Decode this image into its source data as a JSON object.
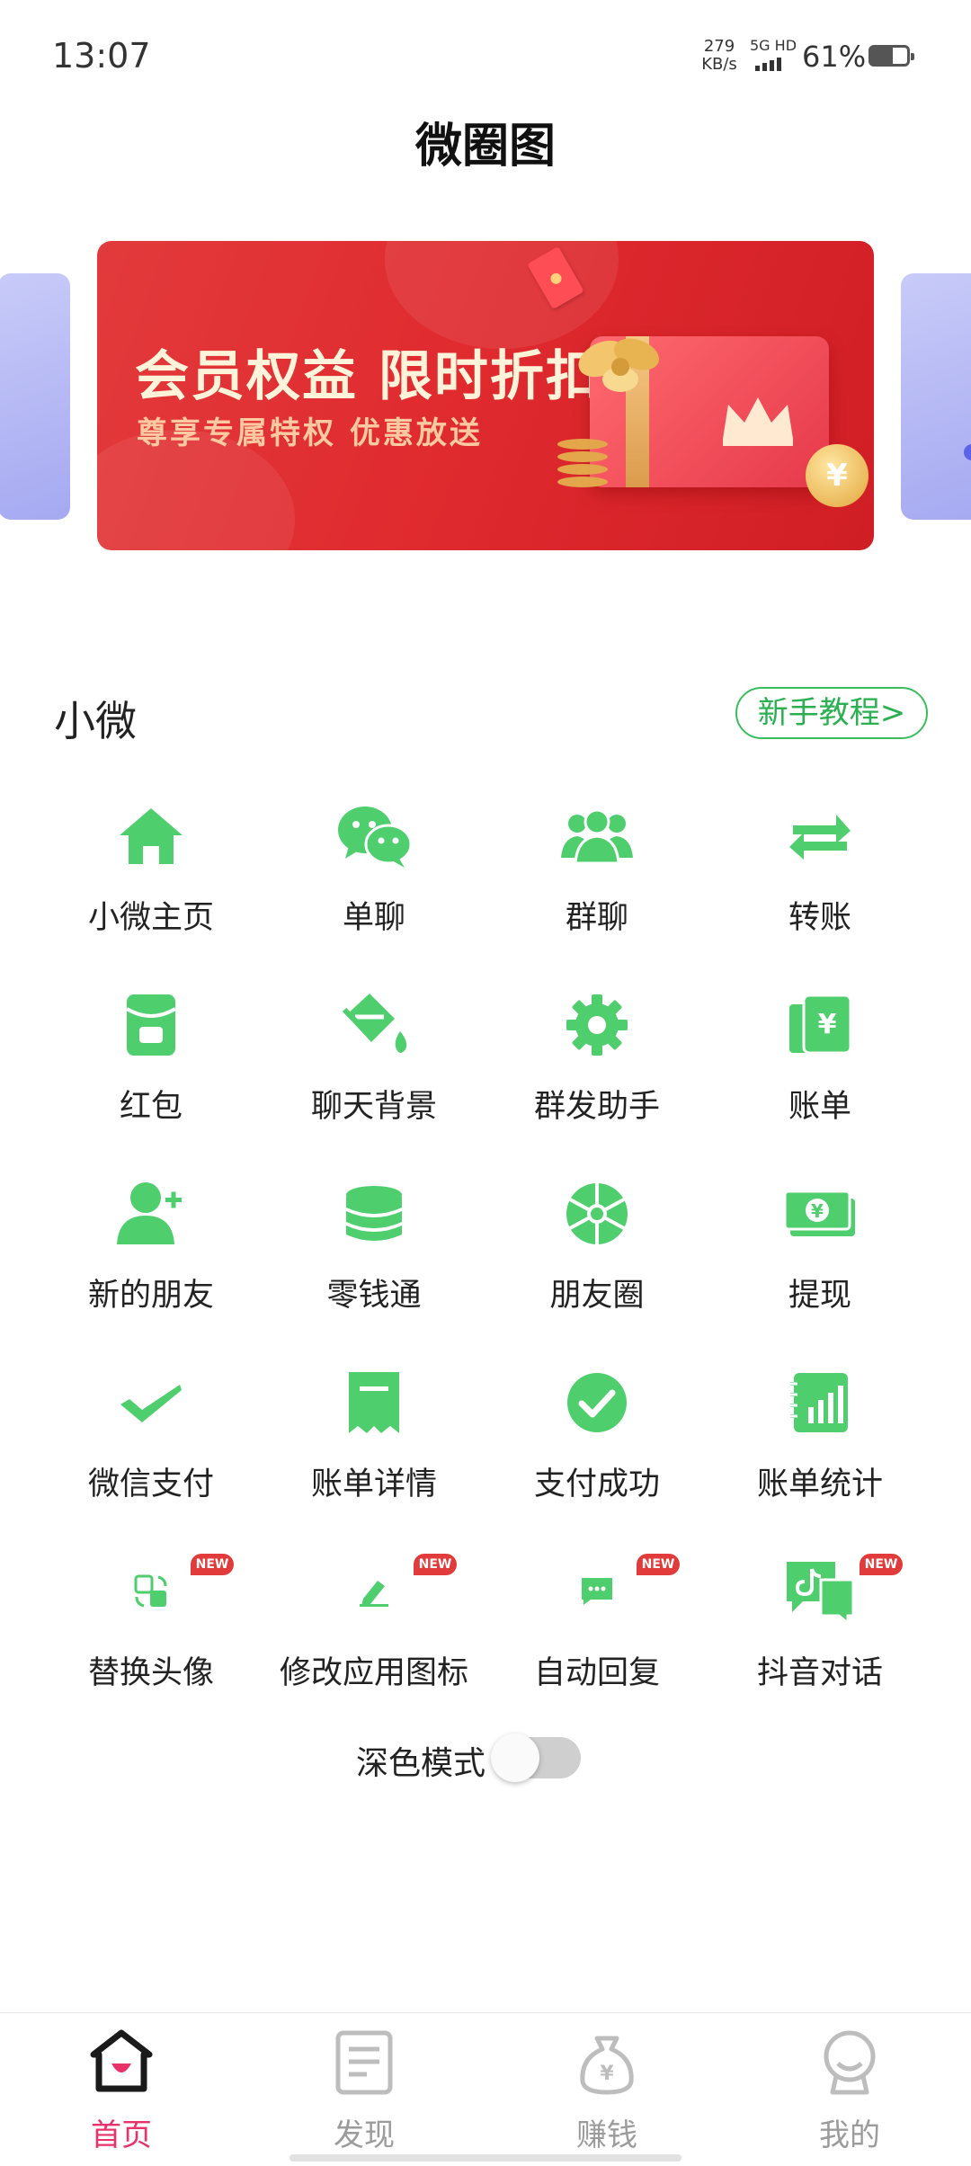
{
  "status_bar": {
    "time": "13:07",
    "net_speed": "279",
    "net_unit": "KB/s",
    "signal_label": "5G HD",
    "battery_pct": "61%",
    "battery_level": 0.61
  },
  "header": {
    "title": "微圈图"
  },
  "banner": {
    "headline": "会员权益 限时折扣",
    "subline": "尊享专属特权 优惠放送",
    "coin_symbol": "¥",
    "brand_color": "#e02b2f"
  },
  "section": {
    "title": "小微",
    "tutorial_label": "新手教程>"
  },
  "accent_color": "#4fce6e",
  "tiles": [
    {
      "label": "小微主页",
      "icon": "home-icon"
    },
    {
      "label": "单聊",
      "icon": "wechat-chat-icon"
    },
    {
      "label": "群聊",
      "icon": "group-icon"
    },
    {
      "label": "转账",
      "icon": "transfer-icon"
    },
    {
      "label": "红包",
      "icon": "red-packet-icon"
    },
    {
      "label": "聊天背景",
      "icon": "paint-bucket-icon"
    },
    {
      "label": "群发助手",
      "icon": "gear-icon"
    },
    {
      "label": "账单",
      "icon": "bill-icon",
      "symbol": "¥"
    },
    {
      "label": "新的朋友",
      "icon": "add-friend-icon"
    },
    {
      "label": "零钱通",
      "icon": "coins-stack-icon"
    },
    {
      "label": "朋友圈",
      "icon": "moments-icon"
    },
    {
      "label": "提现",
      "icon": "cash-icon",
      "symbol": "¥"
    },
    {
      "label": "微信支付",
      "icon": "check-icon"
    },
    {
      "label": "账单详情",
      "icon": "receipt-icon"
    },
    {
      "label": "支付成功",
      "icon": "check-circle-icon"
    },
    {
      "label": "账单统计",
      "icon": "statistics-icon"
    },
    {
      "label": "替换头像",
      "icon": "swap-avatar-icon",
      "badge": "NEW"
    },
    {
      "label": "修改应用图标",
      "icon": "edit-icon",
      "badge": "NEW"
    },
    {
      "label": "自动回复",
      "icon": "message-icon",
      "badge": "NEW"
    },
    {
      "label": "抖音对话",
      "icon": "tiktok-chat-icon",
      "badge": "NEW"
    }
  ],
  "dark_mode": {
    "label": "深色模式",
    "enabled": false
  },
  "bottom_nav": [
    {
      "label": "首页",
      "icon": "home-nav-icon",
      "active": true
    },
    {
      "label": "发现",
      "icon": "document-icon",
      "active": false
    },
    {
      "label": "赚钱",
      "icon": "money-bag-icon",
      "active": false
    },
    {
      "label": "我的",
      "icon": "profile-icon",
      "active": false
    }
  ],
  "nav_active_color": "#e8326a"
}
